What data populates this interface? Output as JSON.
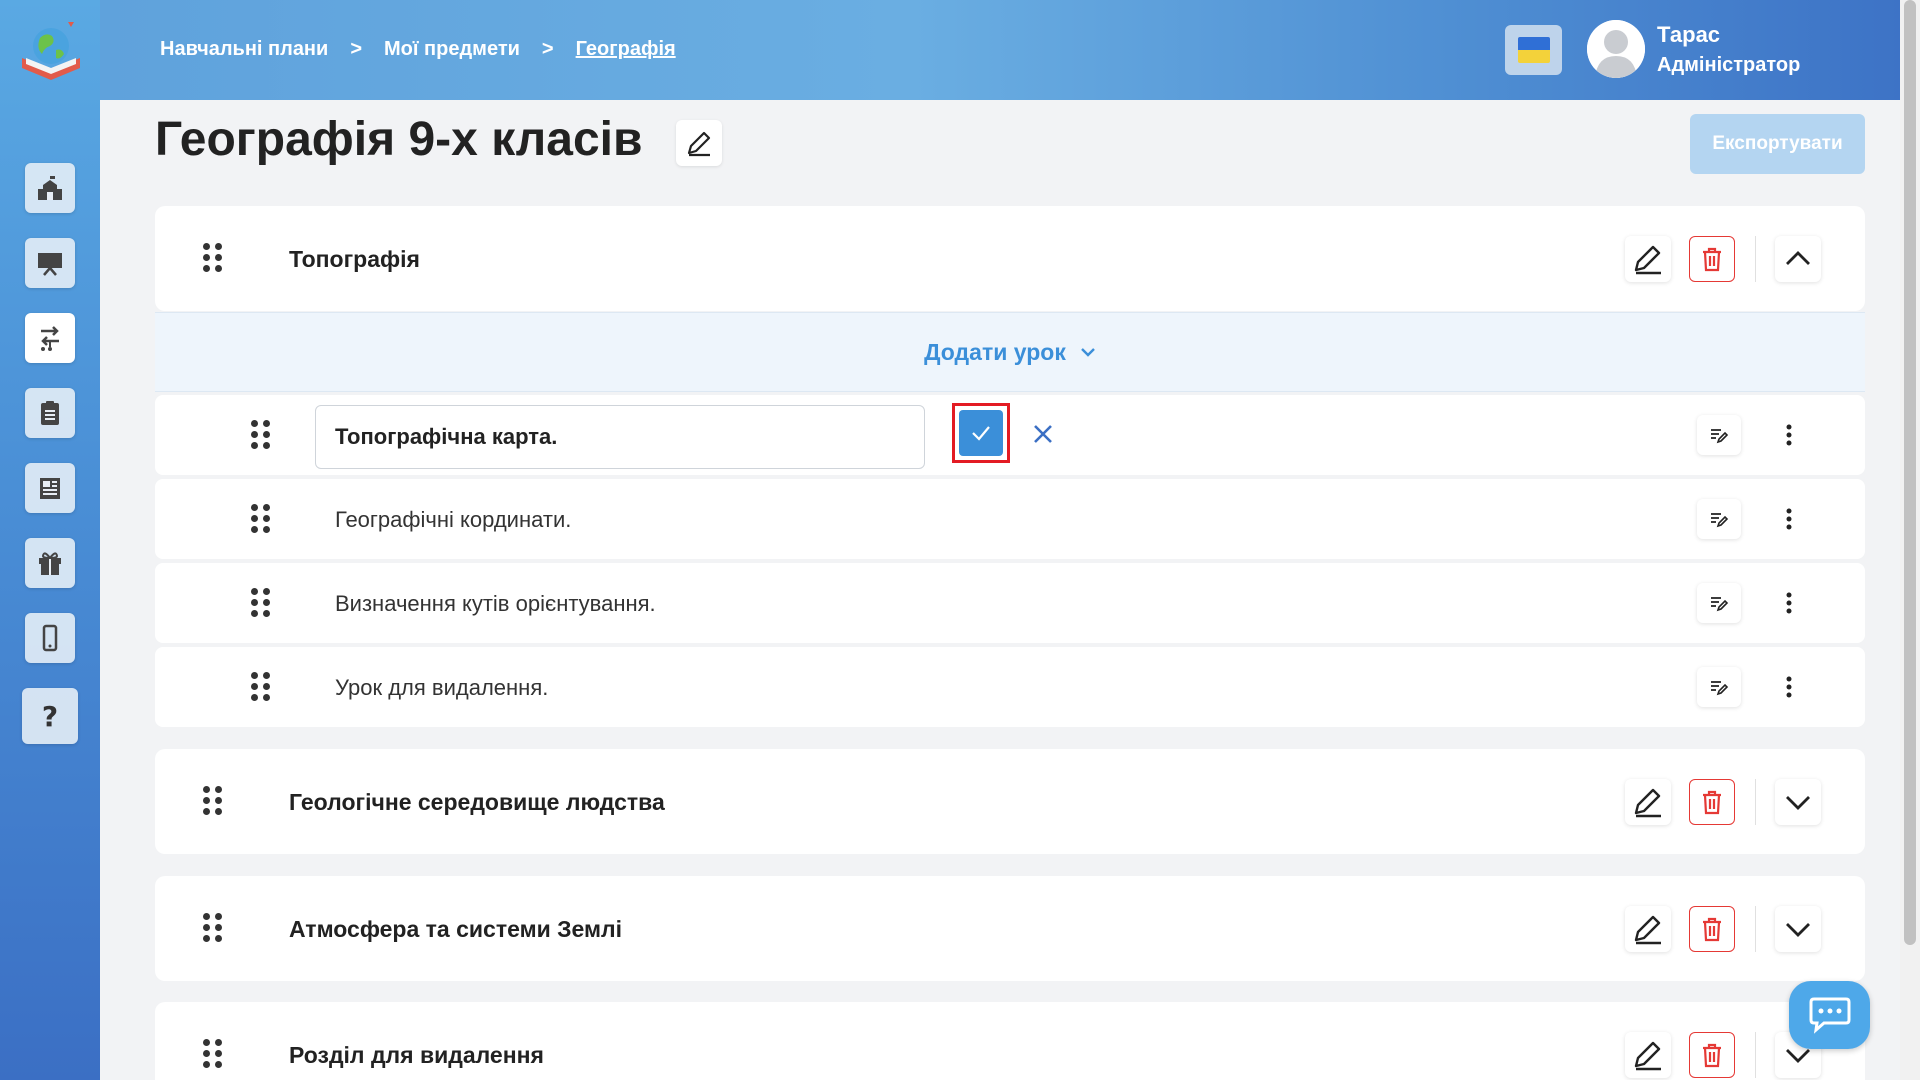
{
  "breadcrumb": {
    "items": [
      "Навчальні плани",
      "Мої предмети",
      "Географія"
    ],
    "separator": ">"
  },
  "user": {
    "name": "Тарас",
    "role": "Адміністратор"
  },
  "page": {
    "title": "Географія 9-х класів",
    "export_label": "Експортувати"
  },
  "add_lesson_label": "Додати урок",
  "sections": [
    {
      "title": "Топографія",
      "expanded": true
    },
    {
      "title": "Геологічне середовище людства",
      "expanded": false
    },
    {
      "title": "Атмосфера та системи Землі",
      "expanded": false
    },
    {
      "title": "Розділ для видалення",
      "expanded": false
    }
  ],
  "lessons": [
    {
      "title": "Топографічна карта.",
      "editing": true
    },
    {
      "title": "Географічні кординати.",
      "editing": false
    },
    {
      "title": "Визначення кутів орієнтування.",
      "editing": false
    },
    {
      "title": "Урок для видалення.",
      "editing": false
    }
  ],
  "sidebar": {
    "items": [
      "school-icon",
      "presentation-icon",
      "route-icon",
      "clipboard-icon",
      "newspaper-icon",
      "gift-icon",
      "mobile-icon",
      "help-icon"
    ],
    "help_label": "?"
  },
  "colors": {
    "accent": "#3b8fd9",
    "delete": "#e53935",
    "highlight": "#e31b23"
  }
}
